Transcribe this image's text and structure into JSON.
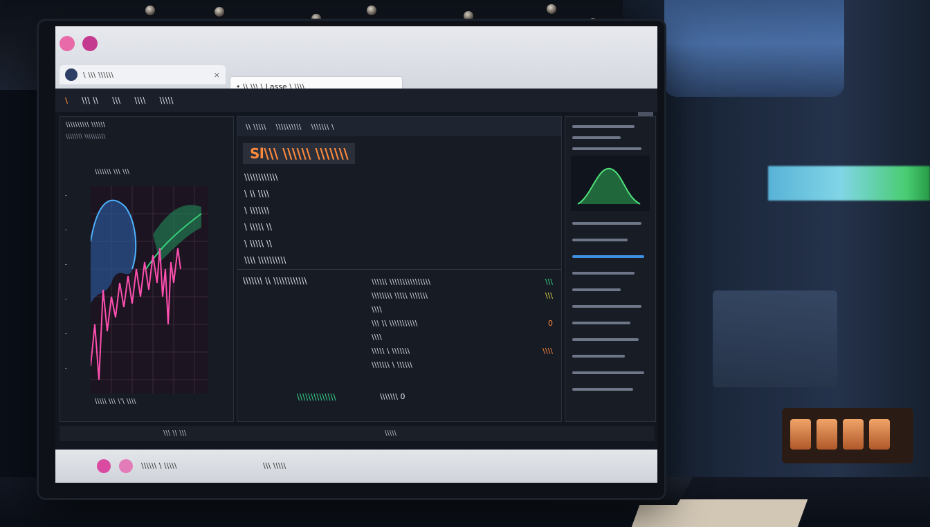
{
  "browser": {
    "tab_label": "\\ \\\\\\ \\\\\\\\\\\\",
    "tab_close": "×",
    "url": "• \\\\ \\\\\\ \\ Lasse \\ \\\\\\\\",
    "toolbar_btn_1": "",
    "toolbar_btn_2": "\\"
  },
  "app_menu": {
    "brand": "\\",
    "items": [
      "\\\\\\ \\\\",
      "\\\\\\",
      "\\\\\\\\",
      "\\\\\\\\\\"
    ]
  },
  "left_panel": {
    "title": "\\\\\\\\\\\\\\\\\\\\ \\\\\\\\\\\\",
    "subtitle": "\\\\\\\\\\\\\\\\ \\\\\\\\\\\\\\\\\\\\",
    "legend": "\\\\\\\\\\\\\\ \\\\\\ \\\\\\",
    "footer": "\\\\\\\\\\ \\\\\\ \\'\\ \\\\\\\\"
  },
  "center_panel": {
    "tabs": [
      "\\\\ \\\\\\\\\\",
      "\\\\\\\\\\\\\\\\\\\\",
      "\\\\\\\\\\\\\\ \\"
    ],
    "heading": "Sl\\\\\\ \\\\\\\\\\\\ \\\\\\\\\\\\\\",
    "lines": [
      "\\\\\\\\\\\\\\\\\\\\\\\\",
      "\\ \\\\ \\\\\\\\",
      "\\ \\\\\\\\\\\\\\",
      "\\ \\\\\\\\\\ \\\\",
      "\\ \\\\\\\\\\ \\\\",
      "\\\\\\\\ \\\\\\\\\\\\\\\\\\\\"
    ],
    "left_label": "\\\\\\\\\\\\\\ \\\\ \\\\\\\\\\\\\\\\\\\\\\\\",
    "rows": [
      {
        "label": "\\\\\\\\\\\\ \\\\\\\\\\\\\\\\\\\\\\\\\\\\\\\\",
        "value": "\\\\\\"
      },
      {
        "label": "\\\\\\\\\\\\\\\\ \\\\\\\\\\ \\\\\\\\\\\\\\",
        "value": "\\\\\\"
      },
      {
        "label": "\\\\\\\\",
        "value": ""
      },
      {
        "label": "\\\\\\ \\\\ \\\\\\\\\\\\\\\\\\\\\\",
        "value": "0"
      },
      {
        "label": "\\\\\\\\",
        "value": ""
      },
      {
        "label": "\\\\\\\\\\ \\ \\\\\\\\\\\\\\",
        "value": "\\\\\\\\"
      },
      {
        "label": "\\\\\\\\\\\\\\ \\ \\\\\\\\\\\\",
        "value": ""
      }
    ],
    "status": "\\\\\\\\\\\\\\\\\\\\\\\\\\\\",
    "status_right": "\\\\\\\\\\\\\\ 0"
  },
  "mid_bar": {
    "left": "\\\\\\ \\\\ \\\\\\",
    "center": "\\\\\\\\\\"
  },
  "taskbar": {
    "label": "\\\\\\\\\\\\ \\ \\\\\\\\\\",
    "center": "\\\\\\ \\\\\\\\\\"
  },
  "colors": {
    "accent_orange": "#ff8a3c",
    "status_green": "#39d98a",
    "chart_pink": "#ff4fb0",
    "chart_blue": "#3d8fe0",
    "chart_green": "#3ad07a"
  }
}
